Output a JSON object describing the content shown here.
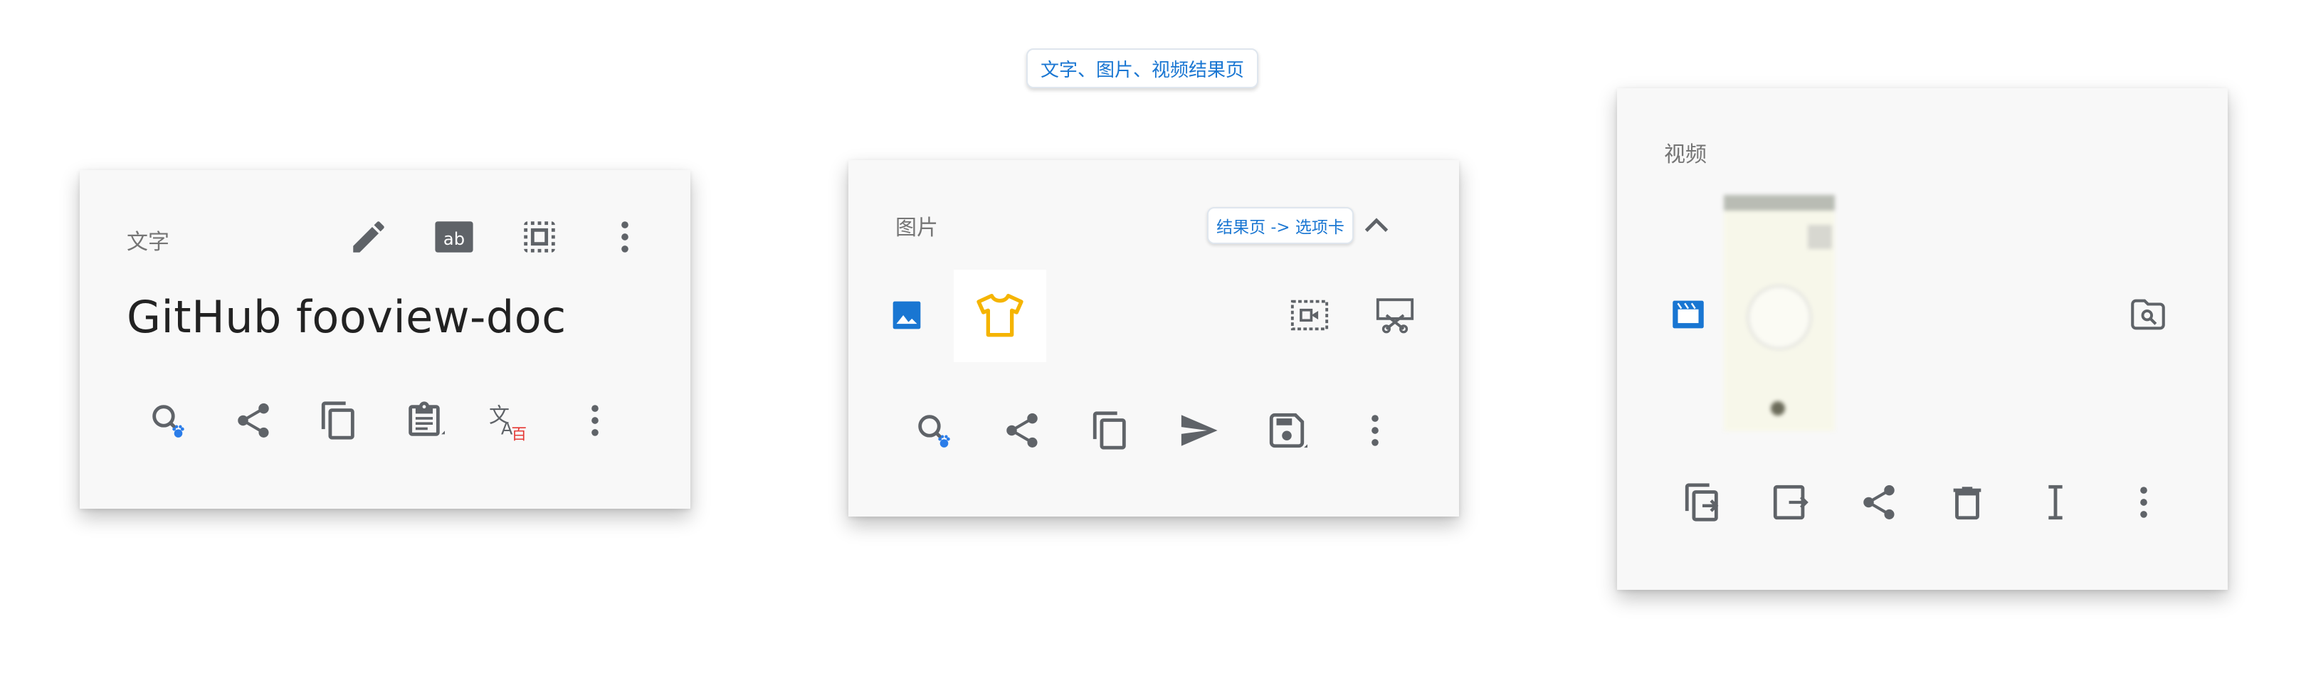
{
  "top_label": "文字、图片、视频结果页",
  "text_card": {
    "title": "文字",
    "content": "GitHub fooview-doc",
    "header_icons": [
      "pencil-icon",
      "ab-icon",
      "select-area-icon",
      "more-vert-icon"
    ],
    "actions": [
      "search-baidu-icon",
      "share-icon",
      "copy-icon",
      "clipboard-icon",
      "translate-baidu-icon",
      "more-vert-icon"
    ],
    "translate_badge": "百",
    "colors": {
      "baidu_blue": "#2b7de9",
      "translate_red": "#e53935"
    }
  },
  "image_card": {
    "title": "图片",
    "tab_label": "结果页 -> 选项卡",
    "header_icons": [
      "chevron-up-icon"
    ],
    "row_icons": [
      "image-icon",
      "shirt-icon",
      "video-frame-icon",
      "screenshot-cut-icon"
    ],
    "actions": [
      "search-baidu-icon",
      "share-icon",
      "copy-icon",
      "send-icon",
      "save-icon",
      "more-vert-icon"
    ],
    "colors": {
      "accent_blue": "#1976d2",
      "shirt_yellow": "#f5b400"
    }
  },
  "video_card": {
    "title": "视频",
    "row_icons": [
      "movie-icon",
      "video-thumbnail",
      "folder-search-icon"
    ],
    "actions": [
      "copy-to-icon",
      "move-to-icon",
      "share-icon",
      "delete-icon",
      "text-cursor-icon",
      "more-vert-icon"
    ],
    "colors": {
      "accent_blue": "#1976d2"
    }
  }
}
